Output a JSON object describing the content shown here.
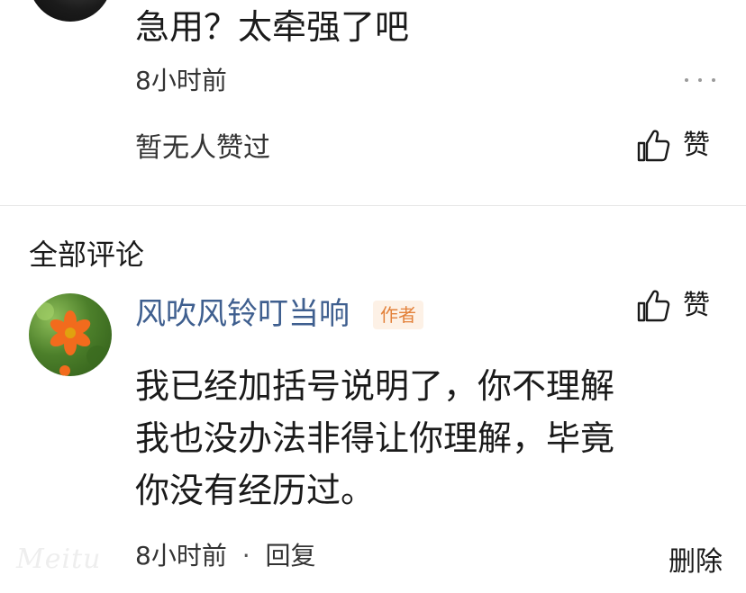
{
  "previous_comment": {
    "text": "急用？太牵强了吧",
    "time": "8小时前",
    "likes_status": "暂无人赞过",
    "like_label": "赞",
    "more_icon": "ellipsis-icon"
  },
  "comments_section": {
    "title": "全部评论"
  },
  "main_comment": {
    "author": "风吹风铃叮当响",
    "badge": "作者",
    "like_label": "赞",
    "lines": [
      "我已经加括号说明了，你不理解",
      "我也没办法非得让你理解，毕竟",
      "你没有经历过。"
    ],
    "time": "8小时前",
    "separator": "·",
    "reply_label": "回复",
    "delete_label": "删除"
  },
  "watermark": "Meitu",
  "colors": {
    "author_link": "#3f5f8f",
    "badge_text": "#e3813a",
    "badge_bg": "#fdf1e6",
    "divider": "#e6e6e6"
  }
}
